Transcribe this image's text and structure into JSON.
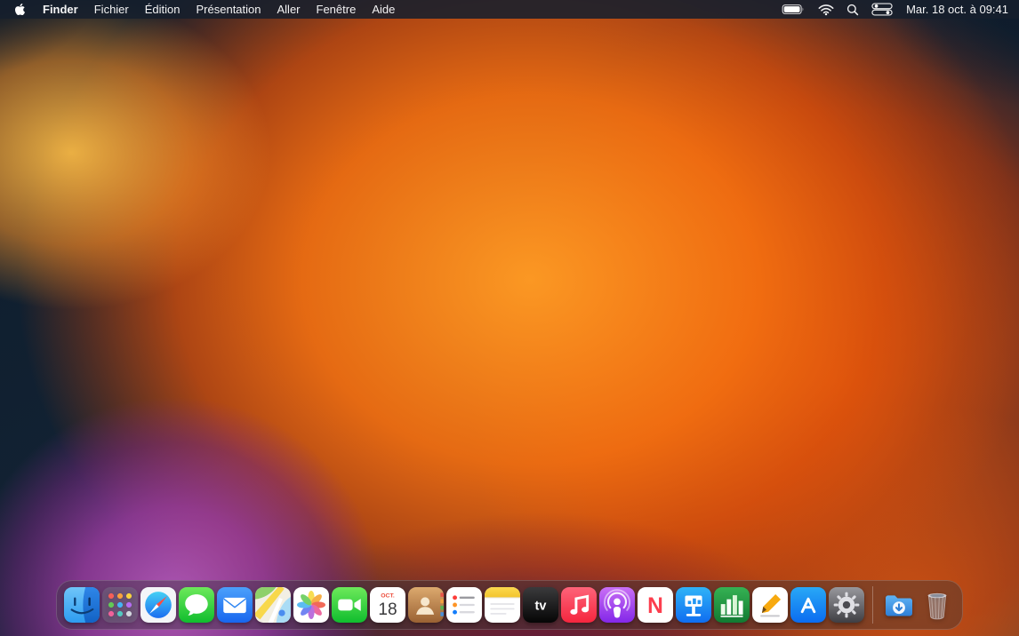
{
  "menu_bar": {
    "active_app": "Finder",
    "items": [
      "Finder",
      "Fichier",
      "Édition",
      "Présentation",
      "Aller",
      "Fenêtre",
      "Aide"
    ],
    "status_icons": [
      "battery-icon",
      "wifi-icon",
      "search-icon",
      "control-center-icon"
    ],
    "clock": "Mar. 18 oct. à 09:41"
  },
  "dock": {
    "calendar_month": "OCT.",
    "calendar_day": "18",
    "tv_logo": "tv",
    "news_logo": "N",
    "apps": [
      "Finder",
      "Launchpad",
      "Safari",
      "Messages",
      "Mail",
      "Plans",
      "Photos",
      "FaceTime",
      "Calendrier",
      "Contacts",
      "Rappels",
      "Notes",
      "TV",
      "Musique",
      "Podcasts",
      "News",
      "Keynote",
      "Numbers",
      "Pages",
      "App Store",
      "Réglages Système"
    ],
    "right_items": [
      "Téléchargements",
      "Corbeille"
    ]
  },
  "colors": {
    "menu_bar_bg": "#161f2c",
    "dock_bg": "rgba(52,52,58,0.42)",
    "wallpaper_orange": "#f7700f",
    "wallpaper_purple": "#a03ca5",
    "wallpaper_navy": "#122233",
    "calendar_red": "#ec4d3c",
    "news_red": "#fc3e4e"
  }
}
